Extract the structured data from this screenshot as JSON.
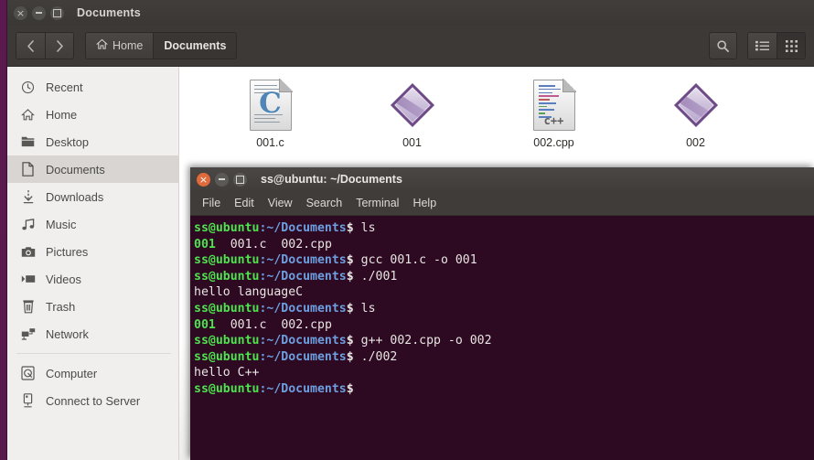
{
  "filemanager": {
    "window_title": "Documents",
    "window_buttons": [
      {
        "name": "close",
        "icon": "close-icon"
      },
      {
        "name": "minimize",
        "icon": "minimize-icon"
      },
      {
        "name": "maximize",
        "icon": "maximize-icon"
      }
    ],
    "toolbar": {
      "back_icon": "chevron-left-icon",
      "forward_icon": "chevron-right-icon",
      "search_icon": "search-icon",
      "list_view_icon": "list-view-icon",
      "grid_view_icon": "grid-view-icon",
      "active_view": "grid"
    },
    "breadcrumbs": [
      {
        "label": "Home",
        "icon": "home-icon",
        "active": false
      },
      {
        "label": "Documents",
        "icon": "",
        "active": true
      }
    ],
    "sidebar": {
      "items": [
        {
          "label": "Recent",
          "icon": "clock-icon",
          "selected": false
        },
        {
          "label": "Home",
          "icon": "home-icon",
          "selected": false
        },
        {
          "label": "Desktop",
          "icon": "folder-icon",
          "selected": false
        },
        {
          "label": "Documents",
          "icon": "document-icon",
          "selected": true
        },
        {
          "label": "Downloads",
          "icon": "download-icon",
          "selected": false
        },
        {
          "label": "Music",
          "icon": "music-note-icon",
          "selected": false
        },
        {
          "label": "Pictures",
          "icon": "camera-icon",
          "selected": false
        },
        {
          "label": "Videos",
          "icon": "video-icon",
          "selected": false
        },
        {
          "label": "Trash",
          "icon": "trash-icon",
          "selected": false
        },
        {
          "label": "Network",
          "icon": "network-icon",
          "selected": false
        }
      ],
      "items2": [
        {
          "label": "Computer",
          "icon": "computer-disk-icon",
          "selected": false
        },
        {
          "label": "Connect to Server",
          "icon": "server-icon",
          "selected": false
        }
      ]
    },
    "files": [
      {
        "label": "001.c",
        "kind": "c-source",
        "badge": "C"
      },
      {
        "label": "001",
        "kind": "executable",
        "badge": ""
      },
      {
        "label": "002.cpp",
        "kind": "cpp-source",
        "badge": "c++"
      },
      {
        "label": "002",
        "kind": "executable",
        "badge": ""
      }
    ]
  },
  "terminal": {
    "window_title": "ss@ubuntu: ~/Documents",
    "window_buttons": [
      {
        "name": "close",
        "icon": "close-icon"
      },
      {
        "name": "minimize",
        "icon": "minimize-icon"
      },
      {
        "name": "maximize",
        "icon": "maximize-icon"
      }
    ],
    "menu": [
      "File",
      "Edit",
      "View",
      "Search",
      "Terminal",
      "Help"
    ],
    "prompt_user": "ss@ubuntu",
    "prompt_path": ":~/Documents",
    "prompt_symbol": "$ ",
    "lines": [
      {
        "type": "prompt",
        "command": "ls"
      },
      {
        "type": "listing",
        "items": [
          "001",
          "001.c",
          "002.cpp"
        ]
      },
      {
        "type": "prompt",
        "command": "gcc 001.c -o 001"
      },
      {
        "type": "prompt",
        "command": "./001"
      },
      {
        "type": "output",
        "text": "hello languageC"
      },
      {
        "type": "prompt",
        "command": "ls"
      },
      {
        "type": "listing",
        "items": [
          "001",
          "001.c",
          "002.cpp"
        ]
      },
      {
        "type": "prompt",
        "command": "g++ 002.cpp -o 002"
      },
      {
        "type": "prompt",
        "command": "./002"
      },
      {
        "type": "output",
        "text": "hello C++"
      },
      {
        "type": "prompt",
        "command": ""
      }
    ],
    "colors": {
      "background": "#2d0922",
      "user": "#4ee44e",
      "path": "#6d9fe0",
      "text": "#e8e5e2"
    }
  },
  "desktop": {
    "background": "#561a4b"
  }
}
